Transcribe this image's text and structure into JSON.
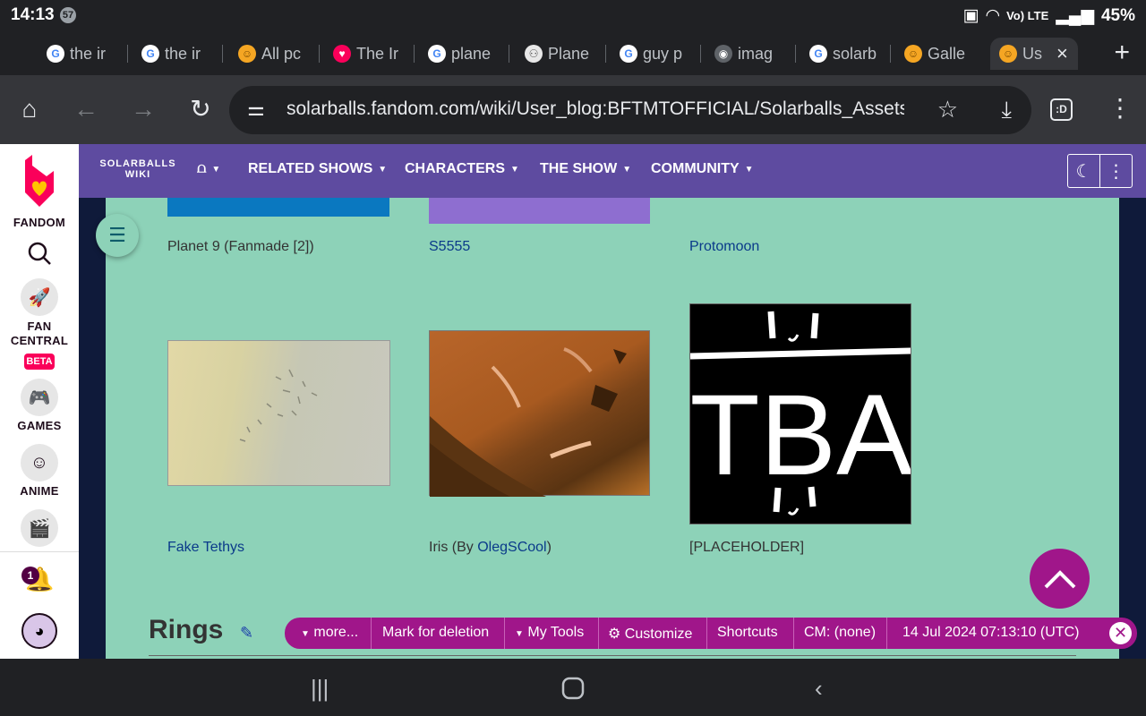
{
  "status": {
    "time": "14:13",
    "notif_count": "57",
    "battery": "45%",
    "net": "Vo) LTE"
  },
  "tabs": [
    {
      "title": "the ir",
      "icon": "google-icon",
      "fav": "G"
    },
    {
      "title": "the ir",
      "icon": "google-icon",
      "fav": "G"
    },
    {
      "title": "All pc",
      "icon": "solarballs-icon",
      "fav": "☺"
    },
    {
      "title": "The Ir",
      "icon": "fandom-icon",
      "fav": "♥"
    },
    {
      "title": "plane",
      "icon": "google-icon",
      "fav": "G"
    },
    {
      "title": "Plane",
      "icon": "people-icon",
      "fav": "⚇"
    },
    {
      "title": "guy p",
      "icon": "google-icon",
      "fav": "G"
    },
    {
      "title": "imag",
      "icon": "globe-icon",
      "fav": "◉"
    },
    {
      "title": "solarb",
      "icon": "google-icon",
      "fav": "G"
    },
    {
      "title": "Galle",
      "icon": "solarballs-icon",
      "fav": "☺"
    },
    {
      "title": "Us",
      "icon": "solarballs-icon",
      "fav": "☺"
    }
  ],
  "toolbar": {
    "url": "solarballs.fandom.com/wiki/User_blog:BFTMTOFFICIAL/Solarballs_Assets",
    "tab_count": ":D"
  },
  "fandom": {
    "brand": "FANDOM",
    "fan_central_line1": "FAN",
    "fan_central_line2": "CENTRAL",
    "beta": "BETA",
    "games": "GAMES",
    "anime": "ANIME",
    "bell_count": "1"
  },
  "wiki": {
    "logo_line1": "SOLARBALLS",
    "logo_line2": "WIKI",
    "nav": [
      "RELATED SHOWS",
      "CHARACTERS",
      "THE SHOW",
      "COMMUNITY"
    ]
  },
  "gallery": {
    "caption_planet9": "Planet 9 (Fanmade [2])",
    "caption_s5555": "S5555",
    "caption_protomoon": "Protomoon",
    "caption_tethys": "Fake Tethys",
    "caption_iris_pre": "Iris (By ",
    "caption_iris_link": "OlegSCool",
    "caption_iris_post": ")",
    "caption_placeholder": "[PLACEHOLDER]",
    "tba_text": "TBA"
  },
  "section": {
    "title": "Rings"
  },
  "adminbar": {
    "more": "more...",
    "mark_delete": "Mark for deletion",
    "my_tools": "My Tools",
    "customize": "Customize",
    "shortcuts": "Shortcuts",
    "cm": "CM: (none)",
    "datetime": "14 Jul 2024 07:13:10 (UTC)"
  },
  "colors": {
    "wiki_bar": "#5e4ba0",
    "content_bg": "#8dd2b8",
    "admin_bar": "#a0168a",
    "fandom_pink": "#fa005a"
  }
}
